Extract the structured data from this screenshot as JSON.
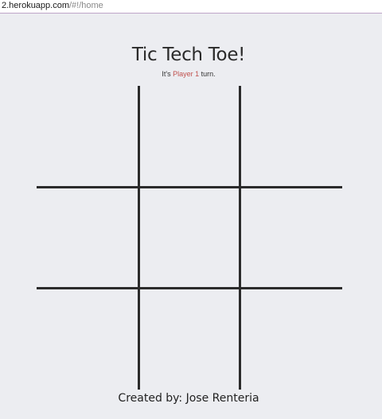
{
  "address_bar": {
    "host": "2.herokuapp.com",
    "path": "/#!/home"
  },
  "game": {
    "title": "Tic Tech Toe!",
    "status_prefix": "It's ",
    "current_player": "Player 1",
    "status_suffix": " turn.",
    "cells": [
      "",
      "",
      "",
      "",
      "",
      "",
      "",
      "",
      ""
    ]
  },
  "footer": {
    "credit": "Created by: Jose Renteria"
  },
  "colors": {
    "background": "#ecedf1",
    "grid": "#2b2b2b",
    "player_highlight": "#c0504d"
  }
}
